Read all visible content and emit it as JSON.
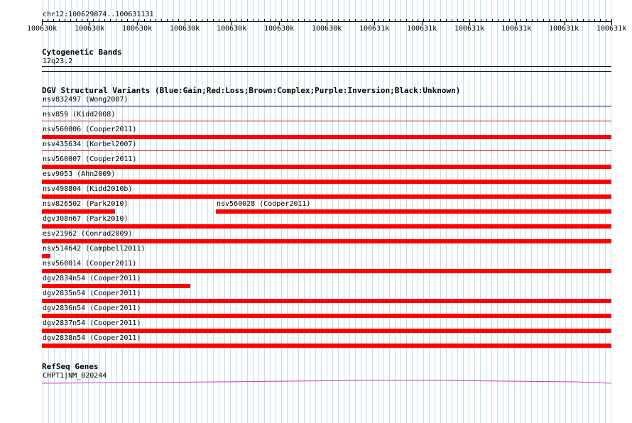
{
  "locus": "chr12:100629874..100631131",
  "ruler": {
    "labels": [
      "100630k",
      "100630k",
      "100630k",
      "100630k",
      "100630k",
      "100630k",
      "100630k",
      "100631k",
      "100631k",
      "100631k",
      "100631k",
      "100631k",
      "100631k"
    ]
  },
  "tracks": {
    "cytobands": {
      "title": "Cytogenetic Bands",
      "band": "12q23.2"
    },
    "dgv": {
      "title": "DGV Structural Variants (Blue:Gain;Red:Loss;Brown:Complex;Purple:Inversion;Black:Unknown)",
      "variants": [
        {
          "label": "nsv832497 (Wong2007)",
          "type": "Gain",
          "start": 0.0,
          "end": 1.0,
          "row_line": true
        },
        {
          "label": "nsv859 (Kidd2008)",
          "type": "Loss",
          "start": 0.0,
          "end": 1.0,
          "row_line": true
        },
        {
          "label": "nsv560006 (Cooper2011)",
          "type": "Loss",
          "start": 0.0,
          "end": 1.0
        },
        {
          "label": "nsv435634 (Korbel2007)",
          "type": "Loss",
          "start": 0.0,
          "end": 1.0,
          "row_line": true
        },
        {
          "label": "nsv560007 (Cooper2011)",
          "type": "Loss",
          "start": 0.0,
          "end": 1.0
        },
        {
          "label": "esv9053 (Ahn2009)",
          "type": "Loss",
          "start": 0.0,
          "end": 1.0
        },
        {
          "label": "nsv498804 (Kidd2010b)",
          "type": "Loss",
          "start": 0.0,
          "end": 1.0
        },
        {
          "label": "nsv826502 (Park2010)",
          "type": "Loss",
          "start": 0.0,
          "end": 0.128
        },
        {
          "label": "nsv560028 (Cooper2011)",
          "type": "Loss",
          "start": 0.306,
          "end": 1.0,
          "same_row_as_previous": true
        },
        {
          "label": "dgv308n67 (Park2010)",
          "type": "Loss",
          "start": 0.0,
          "end": 1.0
        },
        {
          "label": "esv21962 (Conrad2009)",
          "type": "Loss",
          "start": 0.0,
          "end": 1.0
        },
        {
          "label": "nsv514642 (Campbell2011)",
          "type": "Loss",
          "start": 0.0,
          "end": 0.015
        },
        {
          "label": "nsv560014 (Cooper2011)",
          "type": "Loss",
          "start": 0.0,
          "end": 1.0
        },
        {
          "label": "dgv2834n54 (Cooper2011)",
          "type": "Loss",
          "start": 0.0,
          "end": 0.26
        },
        {
          "label": "dgv2835n54 (Cooper2011)",
          "type": "Loss",
          "start": 0.0,
          "end": 1.0
        },
        {
          "label": "dgv2836n54 (Cooper2011)",
          "type": "Loss",
          "start": 0.0,
          "end": 1.0
        },
        {
          "label": "dgv2837n54 (Cooper2011)",
          "type": "Loss",
          "start": 0.0,
          "end": 1.0
        },
        {
          "label": "dgv2838n54 (Cooper2011)",
          "type": "Loss",
          "start": 0.0,
          "end": 1.0
        }
      ]
    },
    "refseq": {
      "title": "RefSeq Genes",
      "gene": "CHPT1|NM_020244"
    }
  },
  "colors": {
    "gain": "#000080",
    "loss": "#ff0000",
    "loss_line": "#cc0000",
    "grid": "#bfe1ea",
    "gene": "#cc33cc"
  }
}
